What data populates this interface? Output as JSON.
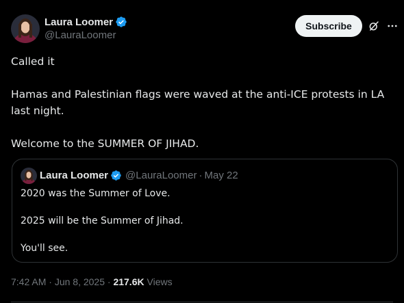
{
  "author": {
    "display_name": "Laura Loomer",
    "handle": "@LauraLoomer",
    "verified": true,
    "verified_color": "#1d9bf0"
  },
  "header_actions": {
    "subscribe_label": "Subscribe",
    "grok_icon": "grok-icon",
    "more_icon": "more-dots-icon"
  },
  "tweet": {
    "text_line_1": "Called it",
    "text_line_2": "Hamas and Palestinian flags were waved at the anti-ICE protests in LA last night.",
    "text_line_3": "Welcome to the SUMMER OF JIHAD."
  },
  "quoted_tweet": {
    "display_name": "Laura Loomer",
    "handle": "@LauraLoomer",
    "separator": "·",
    "date": "May 22",
    "line_1": "2020 was the Summer of Love.",
    "line_2": "2025 will be the Summer of Jihad.",
    "line_3": "You'll see."
  },
  "meta": {
    "time": "7:42 AM",
    "separator": "·",
    "date": "Jun 8, 2025",
    "views_count": "217.6K",
    "views_label": "Views"
  },
  "colors": {
    "background": "#000000",
    "primary_text": "#e7e9ea",
    "secondary_text": "#71767b",
    "border": "#2f3336",
    "subscribe_bg": "#eff3f4"
  }
}
